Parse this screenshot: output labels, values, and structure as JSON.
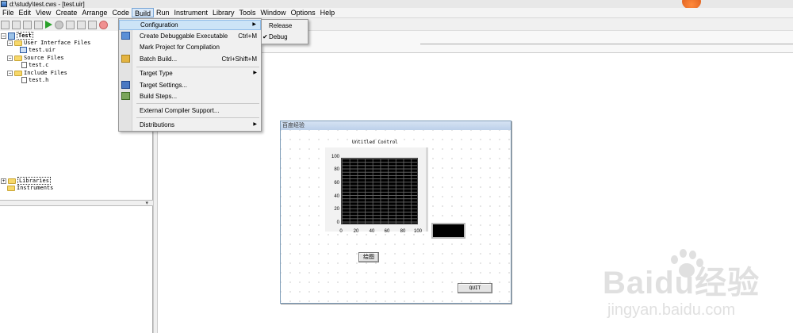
{
  "window": {
    "title": "d:\\study\\test.cws - [test.uir]"
  },
  "menubar": {
    "items": [
      {
        "label": "File"
      },
      {
        "label": "Edit"
      },
      {
        "label": "View"
      },
      {
        "label": "Create"
      },
      {
        "label": "Arrange"
      },
      {
        "label": "Code"
      },
      {
        "label": "Build"
      },
      {
        "label": "Run"
      },
      {
        "label": "Instrument"
      },
      {
        "label": "Library"
      },
      {
        "label": "Tools"
      },
      {
        "label": "Window"
      },
      {
        "label": "Options"
      },
      {
        "label": "Help"
      }
    ],
    "active": "Build"
  },
  "tree": {
    "project": "Test",
    "group_uif": "User Interface Files",
    "file_uir": "test.uir",
    "group_src": "Source Files",
    "file_c": "test.c",
    "group_inc": "Include Files",
    "file_h": "test.h",
    "libraries": "Libraries",
    "instruments": "Instruments"
  },
  "build_menu": {
    "configuration": "Configuration",
    "create_debuggable": "Create Debuggable Executable",
    "create_debuggable_shortcut": "Ctrl+M",
    "mark_project": "Mark Project for Compilation",
    "batch_build": "Batch Build...",
    "batch_build_shortcut": "Ctrl+Shift+M",
    "target_type": "Target Type",
    "target_settings": "Target Settings...",
    "build_steps": "Build Steps...",
    "external_compiler": "External Compiler Support...",
    "distributions": "Distributions"
  },
  "config_submenu": {
    "release": "Release",
    "debug": "Debug",
    "checked": "Debug"
  },
  "panel": {
    "title": "百度经验",
    "graph_label": "Untitled Control",
    "y_ticks": [
      "100",
      "80",
      "60",
      "40",
      "20",
      "0"
    ],
    "x_ticks": [
      "0",
      "20",
      "40",
      "60",
      "80",
      "100"
    ],
    "draw_button": "绘图",
    "quit_button": "QUIT"
  },
  "watermark": {
    "logo": "Baidu经验",
    "url": "jingyan.baidu.com"
  },
  "colors": {
    "menu_highlight": "#cce4f7",
    "panel_title_bg": "#bcd0ea",
    "graph_bg": "#000000"
  }
}
